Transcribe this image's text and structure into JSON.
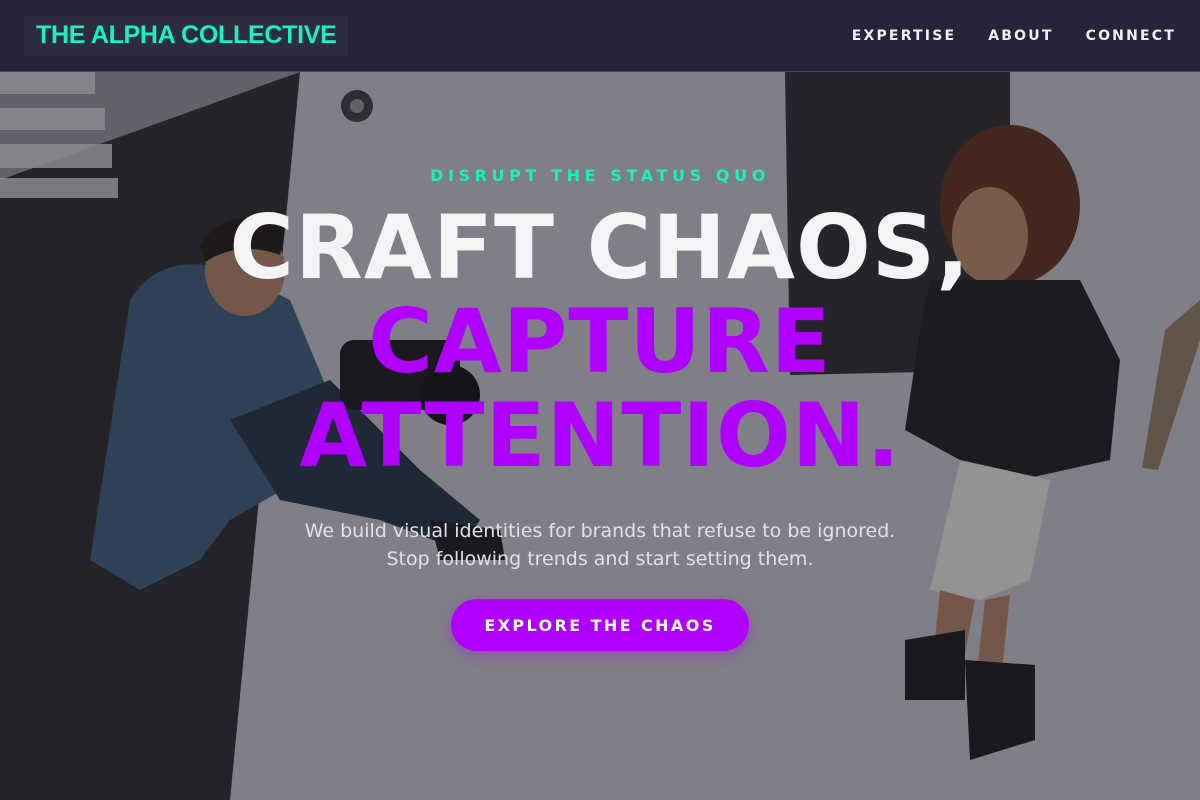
{
  "theme": {
    "brand_color": "#19f2c0",
    "accent_color": "#b000ff",
    "nav_bg": "#26243a"
  },
  "nav": {
    "brand": "THE ALPHA COLLECTIVE",
    "links": [
      {
        "label": "EXPERTISE"
      },
      {
        "label": "ABOUT"
      },
      {
        "label": "CONNECT"
      }
    ]
  },
  "hero": {
    "eyebrow": "DISRUPT THE STATUS QUO",
    "headline_line1": "CRAFT CHAOS,",
    "headline_line2": "CAPTURE",
    "headline_line3": "ATTENTION.",
    "subtext_line1": "We build visual identities for brands that refuse to be ignored.",
    "subtext_line2": "Stop following trends and start setting them.",
    "cta_label": "EXPLORE THE CHAOS",
    "background_image": "photographer-and-model-sitting-on-studio-floor"
  }
}
